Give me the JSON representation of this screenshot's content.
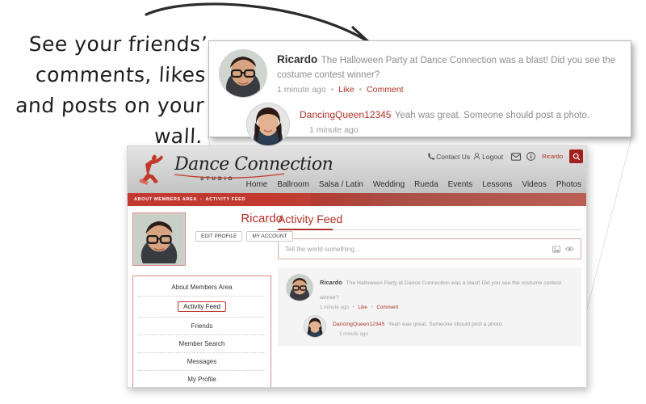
{
  "annotation": {
    "line1": "See your friends’",
    "line2": "comments, likes",
    "line3": "and posts on your",
    "line4": "wall."
  },
  "callout": {
    "post": {
      "author": "Ricardo",
      "text": "The Halloween Party at Dance Connection was a blast! Did you see the costume contest winner?",
      "time": "1 minute ago",
      "like_label": "Like",
      "comment_label": "Comment",
      "separator": "•",
      "avatar_icon": "user-avatar-ricardo"
    },
    "reply": {
      "author": "DancingQueen12345",
      "text": "Yeah was great. Someone should post a photo.",
      "time": "1 minute ago",
      "avatar_icon": "user-avatar-dancingqueen"
    }
  },
  "site": {
    "logo": {
      "name": "Dance Connection",
      "sub": "STUDIO",
      "icon": "dancer-logo-icon"
    },
    "utility": {
      "phone_icon": "phone-icon",
      "contact_label": "Contact Us",
      "person_icon": "person-icon",
      "logout_label": "Logout",
      "mail_icon": "mail-icon",
      "info_icon": "info-icon",
      "username": "Ricardo",
      "search_icon": "search-icon"
    },
    "nav": [
      "Home",
      "Ballroom",
      "Salsa / Latin",
      "Wedding",
      "Rueda",
      "Events",
      "Lessons",
      "Videos",
      "Photos"
    ],
    "breadcrumb": {
      "root": "ABOUT MEMBERS AREA",
      "separator": "›",
      "current": "ACTIVITY FEED"
    },
    "accent_color": "#b03127",
    "search_button_color": "#a32020"
  },
  "profile": {
    "name": "Ricardo",
    "avatar_icon": "profile-photo-ricardo",
    "buttons": [
      "EDIT PROFILE",
      "MY ACCOUNT"
    ]
  },
  "sidebar": {
    "items": [
      {
        "label": "About Members Area",
        "active": false
      },
      {
        "label": "Activity Feed",
        "active": true
      },
      {
        "label": "Friends",
        "active": false
      },
      {
        "label": "Member Search",
        "active": false
      },
      {
        "label": "Messages",
        "active": false
      },
      {
        "label": "My Profile",
        "active": false
      }
    ]
  },
  "main": {
    "title": "Activity Feed",
    "status_placeholder": "Tell the world something...",
    "status_icons": [
      "image-icon",
      "eye-icon"
    ],
    "post": {
      "author": "Ricardo",
      "text": "The Halloween Party at Dance Connection was a blast! Did you see the costume contest winner?",
      "time": "1 minute ago",
      "like_label": "Like",
      "comment_label": "Comment",
      "separator": "•",
      "avatar_icon": "user-avatar-ricardo"
    },
    "reply": {
      "author": "DancingQueen12345",
      "text": "Yeah was great. Someone should post a photo.",
      "time": "1 minute ago",
      "avatar_icon": "user-avatar-dancingqueen"
    }
  }
}
